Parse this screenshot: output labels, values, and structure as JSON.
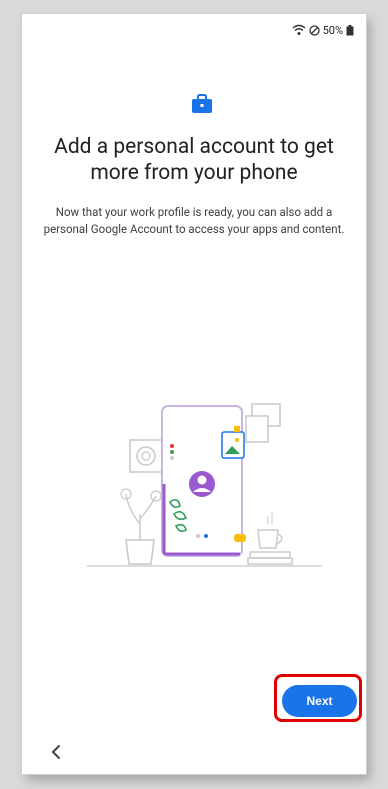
{
  "status_bar": {
    "battery": "50%"
  },
  "header": {
    "icon": "briefcase-icon",
    "title": "Add a personal account to get more from your phone",
    "description": "Now that your work profile is ready, you can also add a personal Google Account to access your apps and content."
  },
  "illustration": {
    "name": "phone-with-profile-illustration"
  },
  "buttons": {
    "next_label": "Next",
    "back_icon": "chevron-left-icon"
  },
  "colors": {
    "accent": "#1a73e8",
    "highlight": "#e00000",
    "illustration_purple": "#9b59d0"
  }
}
